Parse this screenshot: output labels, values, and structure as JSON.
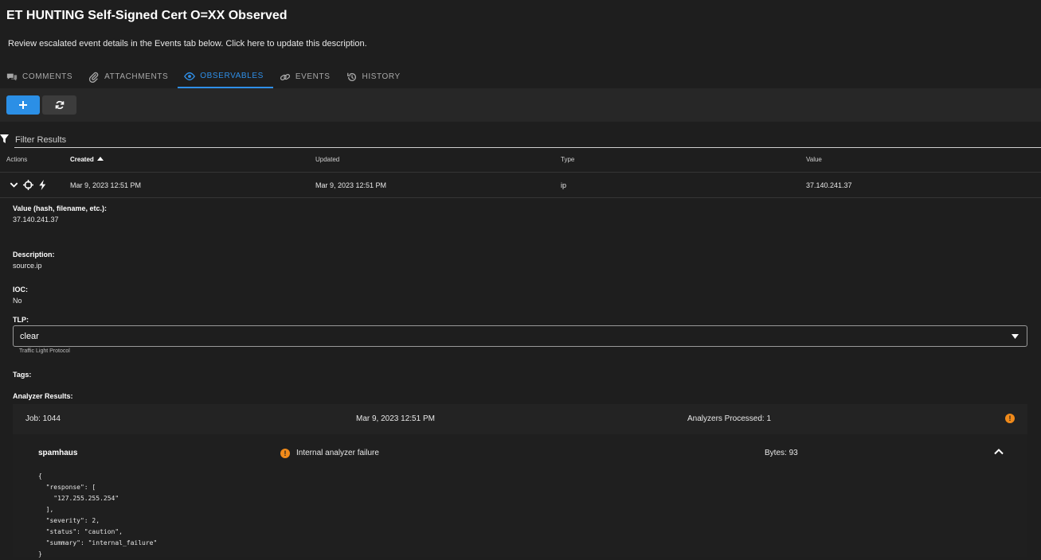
{
  "case": {
    "title": "ET HUNTING Self-Signed Cert O=XX Observed",
    "description": "Review escalated event details in the Events tab below. Click here to update this description."
  },
  "tabs": [
    {
      "label": "COMMENTS",
      "icon": "comments-icon"
    },
    {
      "label": "ATTACHMENTS",
      "icon": "paperclip-icon"
    },
    {
      "label": "OBSERVABLES",
      "icon": "eye-icon",
      "active": true
    },
    {
      "label": "EVENTS",
      "icon": "link-icon"
    },
    {
      "label": "HISTORY",
      "icon": "history-icon"
    }
  ],
  "filter": {
    "placeholder": "Filter Results"
  },
  "table": {
    "headers": {
      "actions": "Actions",
      "created": "Created",
      "updated": "Updated",
      "type": "Type",
      "value": "Value"
    },
    "sort": {
      "column": "created",
      "direction": "ascending"
    },
    "row": {
      "created": "Mar 9, 2023 12:51 PM",
      "updated": "Mar 9, 2023 12:51 PM",
      "type": "ip",
      "value": "37.140.241.37"
    }
  },
  "details": {
    "value_label": "Value (hash, filename, etc.):",
    "value": "37.140.241.37",
    "description_label": "Description:",
    "description": "source.ip",
    "ioc_label": "IOC:",
    "ioc": "No",
    "tlp_label": "TLP:",
    "tlp": "clear",
    "tlp_hint": "Traffic Light Protocol",
    "tags_label": "Tags:",
    "analyzer_label": "Analyzer Results:"
  },
  "job": {
    "id": "Job: 1044",
    "date": "Mar 9, 2023 12:51 PM",
    "processed": "Analyzers Processed: 1",
    "analyzer": {
      "name": "spamhaus",
      "status": "Internal analyzer failure",
      "bytes": "Bytes: 93",
      "json": "{\n  \"response\": [\n    \"127.255.255.254\"\n  ],\n  \"severity\": 2,\n  \"status\": \"caution\",\n  \"summary\": \"internal_failure\"\n}"
    }
  },
  "colors": {
    "accent": "#2f8fe8",
    "warning": "#f08a1a",
    "background": "#1e1e1e"
  }
}
